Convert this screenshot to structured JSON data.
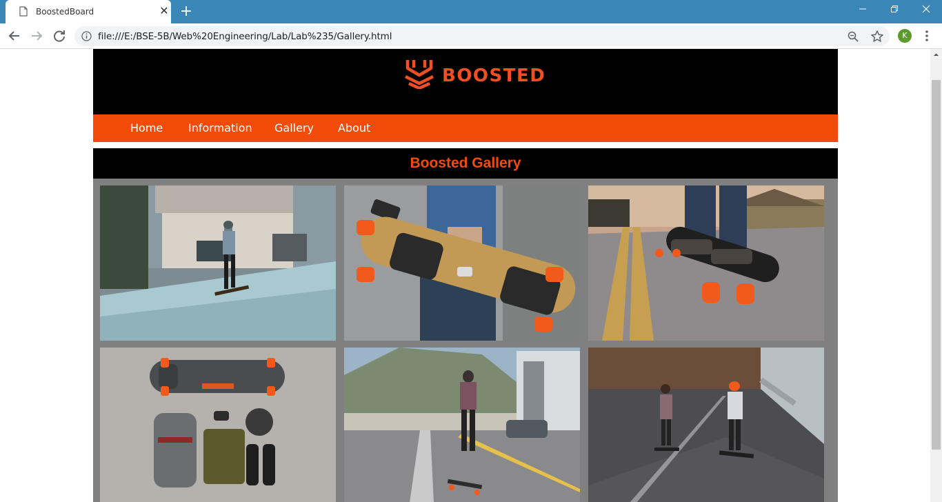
{
  "browser": {
    "tab_title": "BoostedBoard",
    "tab_close": "✕",
    "new_tab": "+",
    "url": "file:///E:/BSE-5B/Web%20Engineering/Lab/Lab%235/Gallery.html",
    "profile_initial": "K",
    "window_controls": {
      "minimize": "—",
      "restore": "❐",
      "close": "✕"
    }
  },
  "site": {
    "brand": "BOOSTED",
    "colors": {
      "accent": "#f44b0a",
      "logo": "#f04e23",
      "header_bg": "#000000",
      "gallery_bg": "#808080"
    },
    "nav": [
      {
        "label": "Home"
      },
      {
        "label": "Information"
      },
      {
        "label": "Gallery"
      },
      {
        "label": "About"
      }
    ],
    "gallery_title": "Boosted Gallery",
    "photos": [
      {
        "subject": "rider-on-city-street"
      },
      {
        "subject": "person-holding-board"
      },
      {
        "subject": "close-up-feet-on-board"
      },
      {
        "subject": "board-and-gear-flatlay"
      },
      {
        "subject": "woman-riding-waterfront"
      },
      {
        "subject": "two-riders-tunnel"
      }
    ]
  }
}
